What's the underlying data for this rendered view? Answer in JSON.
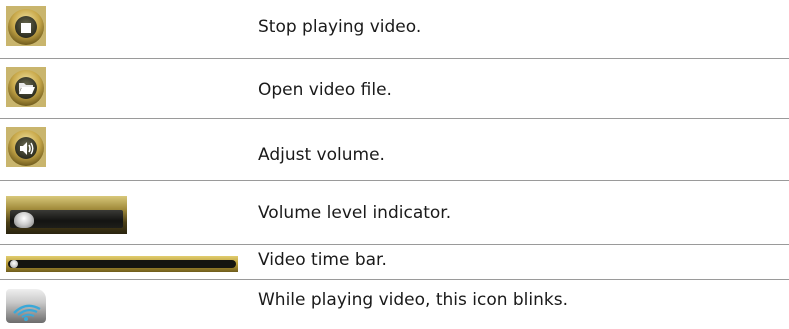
{
  "rows": [
    {
      "icon": "stop-icon",
      "label": "Stop playing video."
    },
    {
      "icon": "open-folder-icon",
      "label": "Open video file."
    },
    {
      "icon": "speaker-icon",
      "label": "Adjust volume."
    },
    {
      "icon": "volume-slider-icon",
      "label": "Volume level indicator.",
      "level": 0.05
    },
    {
      "icon": "time-bar-icon",
      "label": "Video time bar.",
      "progress": 0.0
    },
    {
      "icon": "wireless-signal-icon",
      "label": "While playing video, this icon blinks."
    }
  ],
  "colors": {
    "gold": "#c9a94a",
    "divider": "#9a9a9a",
    "text": "#1a1a1a"
  }
}
